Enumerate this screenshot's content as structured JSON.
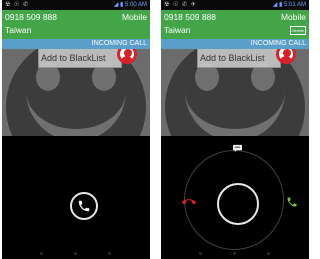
{
  "screens": [
    {
      "status": {
        "left_icons": "☢ ☉ ✆",
        "right": "◢ ▮ 5:00 AM"
      },
      "caller": {
        "number": "0918 509 888",
        "type": "Mobile",
        "location": "Taiwan"
      },
      "incoming_label": "INCOMING CALL",
      "blacklist_label": "Add to BlackList"
    },
    {
      "status": {
        "left_icons": "☢ ☉ ✆ ✈",
        "right": "◢ ▮ 5:01 AM"
      },
      "caller": {
        "number": "0918 509 888",
        "type": "Mobile",
        "location": "Taiwan",
        "badge": "Mobile"
      },
      "incoming_label": "INCOMING CALL",
      "blacklist_label": "Add to BlackList"
    }
  ],
  "colors": {
    "caller_bar": "#43a548",
    "incoming_bar": "#5a9fc9",
    "decline": "#d6222a",
    "accept": "#7bc043"
  },
  "icons": [
    "blacklist-icon",
    "answer-phone-icon",
    "message-icon",
    "decline-call-icon",
    "accept-call-icon"
  ]
}
